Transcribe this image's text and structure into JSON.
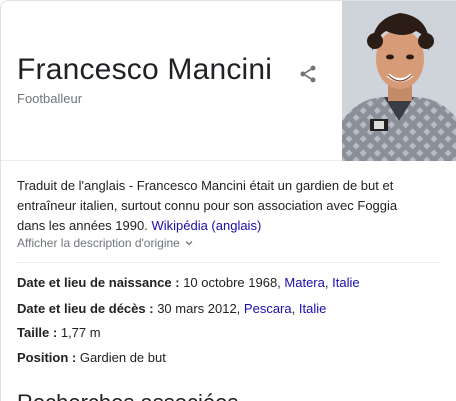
{
  "header": {
    "title": "Francesco Mancini",
    "subtitle": "Footballeur",
    "share_icon": "share-icon",
    "photo_alt": "Francesco Mancini"
  },
  "description": {
    "text": "Traduit de l'anglais - Francesco Mancini était un gardien de but et entraîneur italien, surtout connu pour son association avec Foggia dans les années 1990.",
    "source_link": "Wikipédia (anglais)",
    "show_original": "Afficher la description d'origine"
  },
  "facts": [
    {
      "label": "Date et lieu de naissance :",
      "value": "10 octobre 1968,",
      "links": [
        "Matera",
        "Italie"
      ]
    },
    {
      "label": "Date et lieu de décès :",
      "value": "30 mars 2012,",
      "links": [
        "Pescara",
        "Italie"
      ]
    },
    {
      "label": "Taille :",
      "value": "1,77 m",
      "links": []
    },
    {
      "label": "Position :",
      "value": "Gardien de but",
      "links": []
    }
  ],
  "related": {
    "title": "Recherches associées"
  },
  "colors": {
    "link": "#1a0dab",
    "muted": "#70757a",
    "text": "#222222"
  }
}
